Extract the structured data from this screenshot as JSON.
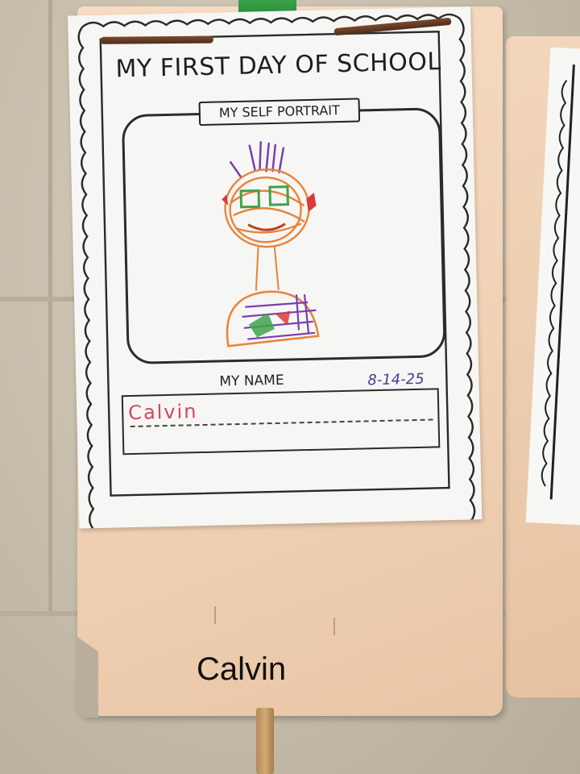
{
  "worksheet": {
    "title": "MY FIRST DAY OF SCHOOL",
    "subtitle": "MY SELF PORTRAIT",
    "name_label": "MY NAME",
    "date": "8-14-25",
    "written_name": "Calvin"
  },
  "folder": {
    "label": "Calvin"
  },
  "colors": {
    "crayon_orange": "#e8833a",
    "crayon_purple": "#7a3fb0",
    "crayon_green": "#3fa34a",
    "crayon_red": "#d93a3a",
    "pen_blue": "#4b3a9c",
    "folder_manila": "#f0d1b4"
  }
}
